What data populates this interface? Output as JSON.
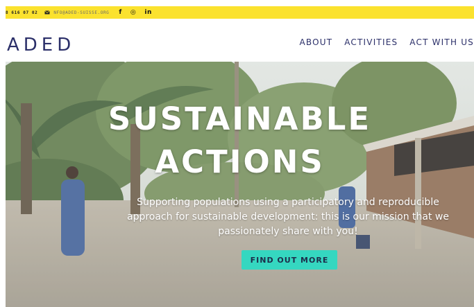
{
  "topbar": {
    "phone": "8 616 07 02",
    "email": "NFO@ADED-SUISSE.ORG",
    "social": {
      "facebook": "f",
      "instagram": "◎",
      "linkedin": "in"
    }
  },
  "header": {
    "logo": "ADED",
    "menu": [
      "ABOUT",
      "ACTIVITIES",
      "ACT WITH US"
    ]
  },
  "hero": {
    "title_line1": "SUSTAINABLE",
    "title_line2": "ACTIONS",
    "subtitle_line1": "Supporting populations using a participatory and reproducible",
    "subtitle_line2": "approach for sustainable development: this is our mission that we",
    "subtitle_line3": "passionately share with you!",
    "cta": "FIND OUT MORE"
  },
  "colors": {
    "topbar": "#fbe22e",
    "brand": "#2b2f69",
    "cta": "#35d7c0"
  }
}
